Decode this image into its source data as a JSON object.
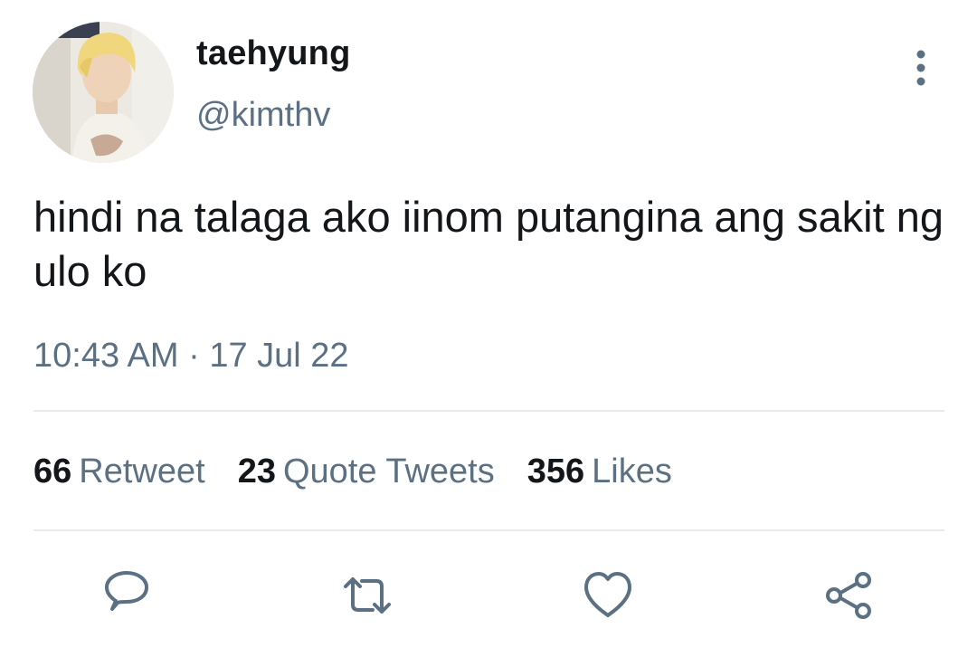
{
  "author": {
    "display_name": "taehyung",
    "handle": "@kimthv"
  },
  "tweet": {
    "text": "hindi na talaga ako iinom putangina ang sakit ng ulo ko",
    "timestamp": "10:43 AM · 17 Jul 22"
  },
  "stats": [
    {
      "count": "66",
      "label": "Retweet"
    },
    {
      "count": "23",
      "label": "Quote Tweets"
    },
    {
      "count": "356",
      "label": "Likes"
    }
  ],
  "icons": {
    "more": "more-vertical-icon",
    "reply": "reply-icon",
    "retweet": "retweet-icon",
    "like": "heart-icon",
    "share": "share-icon"
  },
  "colors": {
    "primary_text": "#14171a",
    "secondary_text": "#5b7083",
    "divider": "#e6ecf0"
  }
}
